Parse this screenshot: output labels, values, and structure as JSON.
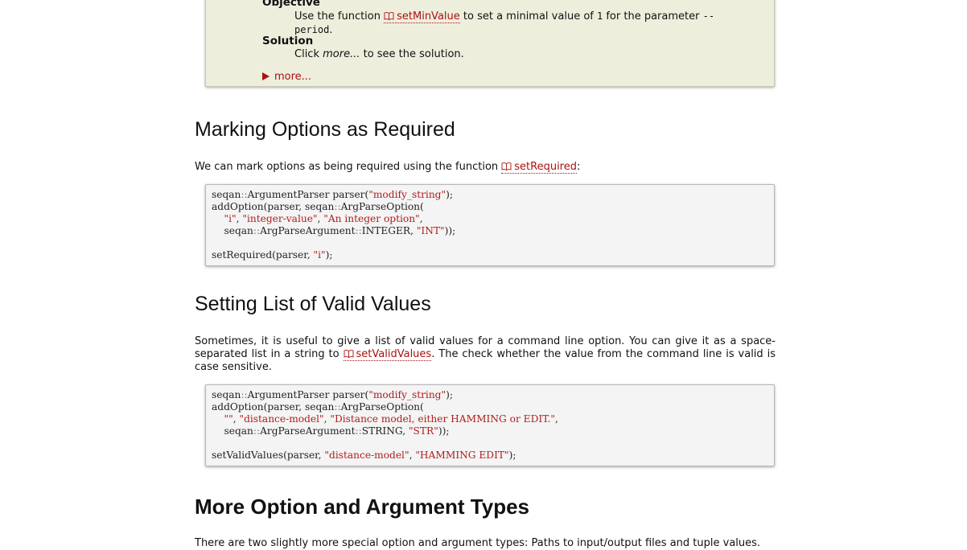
{
  "assignment": {
    "objective_label": "Objective",
    "objective_pre": "Use the function ",
    "objective_link": "setMinValue",
    "objective_mid": " to set a minimal value of ",
    "objective_value": "1",
    "objective_post": " for the parameter ",
    "objective_param": "--",
    "objective_param2": "period",
    "objective_end": ".",
    "solution_label": "Solution",
    "solution_pre": "Click ",
    "solution_em": "more...",
    "solution_post": " to see the solution.",
    "more_label": "more..."
  },
  "section_required": {
    "heading": "Marking Options as Required",
    "text_pre": "We can mark options as being required using the function ",
    "link": "setRequired",
    "text_post": ":",
    "code": [
      [
        {
          "t": "seqan"
        },
        {
          "t": "::",
          "c": "op"
        },
        {
          "t": "ArgumentParser parser("
        },
        {
          "t": "\"modify_string\"",
          "c": "s"
        },
        {
          "t": ");"
        }
      ],
      [
        {
          "t": "addOption(parser, seqan"
        },
        {
          "t": "::",
          "c": "op"
        },
        {
          "t": "ArgParseOption("
        }
      ],
      [
        {
          "t": "    "
        },
        {
          "t": "\"i\"",
          "c": "s"
        },
        {
          "t": ", "
        },
        {
          "t": "\"integer-value\"",
          "c": "s"
        },
        {
          "t": ", "
        },
        {
          "t": "\"An integer option\"",
          "c": "s"
        },
        {
          "t": ","
        }
      ],
      [
        {
          "t": "    seqan"
        },
        {
          "t": "::",
          "c": "op"
        },
        {
          "t": "ArgParseArgument"
        },
        {
          "t": "::",
          "c": "op"
        },
        {
          "t": "INTEGER, "
        },
        {
          "t": "\"INT\"",
          "c": "s"
        },
        {
          "t": "));"
        }
      ],
      [
        {
          "t": ""
        }
      ],
      [
        {
          "t": "setRequired(parser, "
        },
        {
          "t": "\"i\"",
          "c": "s"
        },
        {
          "t": ");"
        }
      ]
    ]
  },
  "section_valid": {
    "heading": "Setting List of Valid Values",
    "text_pre": "Sometimes, it is useful to give a list of valid values for a command line option. You can give it as a space-separated list in a string to ",
    "link": "setValidValues",
    "text_post": ". The check whether the value from the command line is valid is case sensitive.",
    "code": [
      [
        {
          "t": "seqan"
        },
        {
          "t": "::",
          "c": "op"
        },
        {
          "t": "ArgumentParser parser("
        },
        {
          "t": "\"modify_string\"",
          "c": "s"
        },
        {
          "t": ");"
        }
      ],
      [
        {
          "t": "addOption(parser, seqan"
        },
        {
          "t": "::",
          "c": "op"
        },
        {
          "t": "ArgParseOption("
        }
      ],
      [
        {
          "t": "    "
        },
        {
          "t": "\"\"",
          "c": "s"
        },
        {
          "t": ", "
        },
        {
          "t": "\"distance-model\"",
          "c": "s"
        },
        {
          "t": ", "
        },
        {
          "t": "\"Distance model, either HAMMING or EDIT.\"",
          "c": "s"
        },
        {
          "t": ","
        }
      ],
      [
        {
          "t": "    seqan"
        },
        {
          "t": "::",
          "c": "op"
        },
        {
          "t": "ArgParseArgument"
        },
        {
          "t": "::",
          "c": "op"
        },
        {
          "t": "STRING, "
        },
        {
          "t": "\"STR\"",
          "c": "s"
        },
        {
          "t": "));"
        }
      ],
      [
        {
          "t": ""
        }
      ],
      [
        {
          "t": "setValidValues(parser, "
        },
        {
          "t": "\"distance-model\"",
          "c": "s"
        },
        {
          "t": ", "
        },
        {
          "t": "\"HAMMING EDIT\"",
          "c": "s"
        },
        {
          "t": ");"
        }
      ]
    ]
  },
  "section_more": {
    "heading": "More Option and Argument Types",
    "text": "There are two slightly more special option and argument types: Paths to input/output files and tuple values."
  },
  "colors": {
    "link": "#aa1111",
    "assignment_bg": "#eeeedd",
    "code_bg": "#f4f4f4",
    "string": "#b01c1c"
  },
  "icons": {
    "doc_link": "book-icon",
    "disclosure": "triangle-right-icon"
  }
}
